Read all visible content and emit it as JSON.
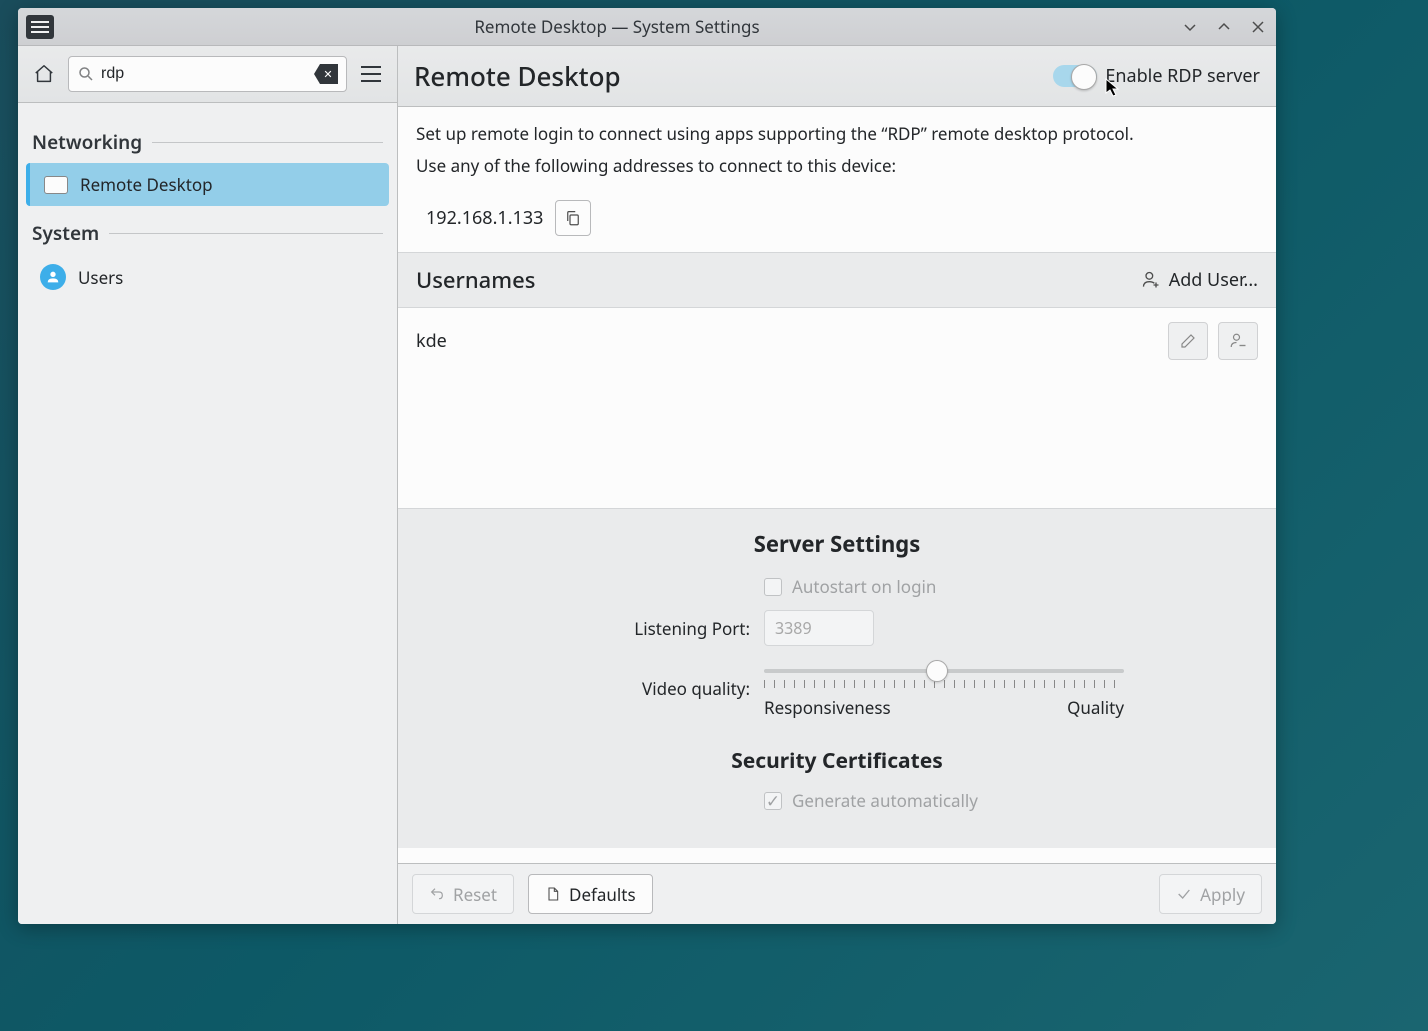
{
  "window": {
    "title": "Remote Desktop — System Settings"
  },
  "sidebar": {
    "search_value": "rdp",
    "sections": [
      {
        "label": "Networking"
      },
      {
        "label": "System"
      }
    ],
    "items": {
      "remote_desktop": "Remote Desktop",
      "users": "Users"
    }
  },
  "main": {
    "title": "Remote Desktop",
    "toggle_label": "Enable RDP server",
    "intro1": "Set up remote login to connect using apps supporting the “RDP” remote desktop protocol.",
    "intro2": "Use any of the following addresses to connect to this device:",
    "address": "192.168.1.133",
    "usernames_title": "Usernames",
    "add_user_label": "Add User...",
    "users": [
      {
        "name": "kde"
      }
    ],
    "server_settings_title": "Server Settings",
    "autostart_label": "Autostart on login",
    "listening_port_label": "Listening Port:",
    "listening_port_value": "3389",
    "video_quality_label": "Video quality:",
    "slider_left": "Responsiveness",
    "slider_right": "Quality",
    "cert_title": "Security Certificates",
    "cert_auto_label": "Generate automatically"
  },
  "footer": {
    "reset": "Reset",
    "defaults": "Defaults",
    "apply": "Apply"
  }
}
